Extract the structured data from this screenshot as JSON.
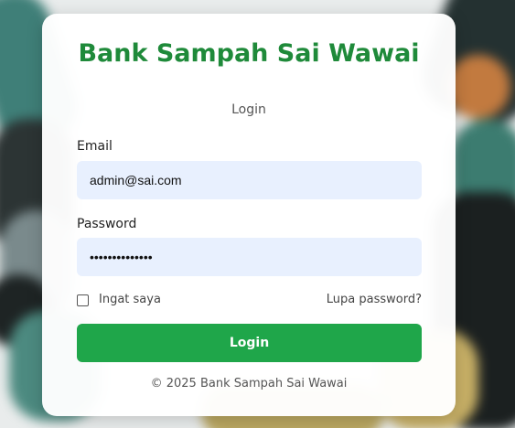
{
  "app": {
    "title": "Bank Sampah Sai Wawai",
    "subtitle": "Login"
  },
  "form": {
    "email_label": "Email",
    "email_value": "admin@sai.com",
    "password_label": "Password",
    "password_value": "••••••••••••••",
    "remember_label": "Ingat saya",
    "remember_checked": false,
    "forgot_label": "Lupa password?",
    "submit_label": "Login"
  },
  "footer": {
    "copyright": "© 2025 Bank Sampah Sai Wawai"
  },
  "colors": {
    "brand_green": "#1f8a3a",
    "button_green": "#1fa64a",
    "input_bg": "#e8f0fe"
  }
}
